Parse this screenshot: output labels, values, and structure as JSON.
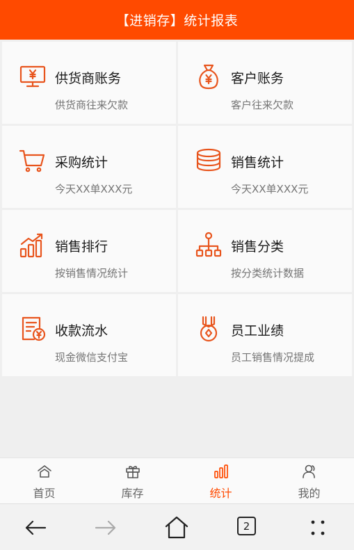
{
  "header": {
    "title": "【进销存】统计报表"
  },
  "cards": [
    {
      "icon": "monitor-yen-icon",
      "title": "供货商账务",
      "subtitle": "供货商往来欠款"
    },
    {
      "icon": "money-bag-icon",
      "title": "客户账务",
      "subtitle": "客户往来欠款"
    },
    {
      "icon": "shopping-cart-icon",
      "title": "采购统计",
      "subtitle": "今天XX单XXX元"
    },
    {
      "icon": "coin-stack-icon",
      "title": "销售统计",
      "subtitle": "今天XX单XXX元"
    },
    {
      "icon": "bar-chart-up-icon",
      "title": "销售排行",
      "subtitle": "按销售情况统计"
    },
    {
      "icon": "hierarchy-icon",
      "title": "销售分类",
      "subtitle": "按分类统计数据"
    },
    {
      "icon": "receipt-yen-icon",
      "title": "收款流水",
      "subtitle": "现金微信支付宝"
    },
    {
      "icon": "medal-icon",
      "title": "员工业绩",
      "subtitle": "员工销售情况提成"
    }
  ],
  "tabs": [
    {
      "label": "首页",
      "icon": "home-icon"
    },
    {
      "label": "库存",
      "icon": "gift-icon"
    },
    {
      "label": "统计",
      "icon": "stats-icon",
      "active": true
    },
    {
      "label": "我的",
      "icon": "user-icon"
    }
  ],
  "browser": {
    "tab_count": "2"
  },
  "colors": {
    "accent": "#ff4a00",
    "header_bg": "#ff4a00"
  }
}
